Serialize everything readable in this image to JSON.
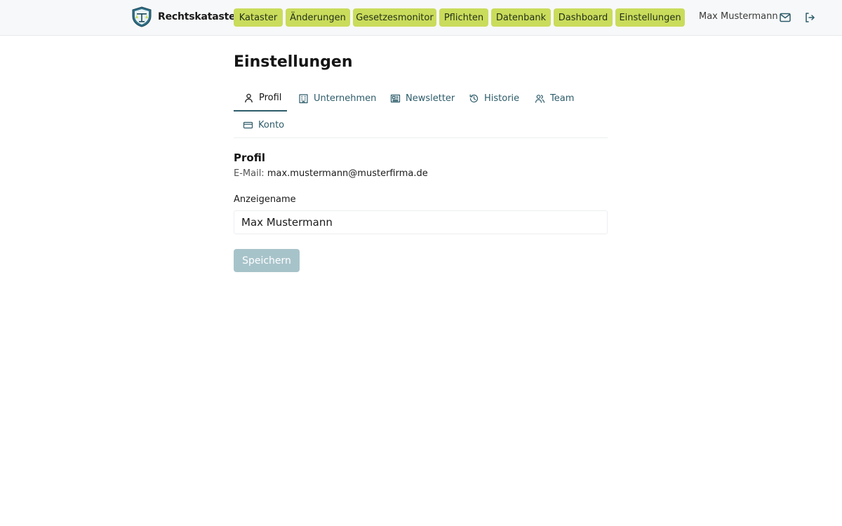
{
  "app": {
    "brand_name": "Rechtskataster"
  },
  "nav": {
    "items": [
      {
        "label": "Kataster"
      },
      {
        "label": "Änderungen"
      },
      {
        "label": "Gesetzesmonitor"
      },
      {
        "label": "Pflichten"
      },
      {
        "label": "Datenbank"
      },
      {
        "label": "Dashboard"
      },
      {
        "label": "Einstellungen"
      }
    ]
  },
  "user": {
    "name": "Max Mustermann"
  },
  "icons": {
    "messages": "mail-icon",
    "logout": "logout-icon"
  },
  "page": {
    "title": "Einstellungen"
  },
  "tabs": [
    {
      "label": "Profil",
      "icon": "user-icon",
      "active": true
    },
    {
      "label": "Unternehmen",
      "icon": "building-icon"
    },
    {
      "label": "Newsletter",
      "icon": "newspaper-icon"
    },
    {
      "label": "Historie",
      "icon": "history-icon"
    },
    {
      "label": "Team",
      "icon": "team-icon"
    },
    {
      "label": "Konto",
      "icon": "credit-card-icon"
    }
  ],
  "profile": {
    "section_title": "Profil",
    "email_label": "E-Mail:",
    "email": "max.mustermann@musterfirma.de",
    "display_name_label": "Anzeigename",
    "display_name_value": "Max Mustermann",
    "save_label": "Speichern"
  },
  "colors": {
    "nav_pill": "#cadc5b",
    "accent": "#2d5c6a",
    "save_button": "#a7c3ca",
    "topbar": "#f7f8f9"
  }
}
